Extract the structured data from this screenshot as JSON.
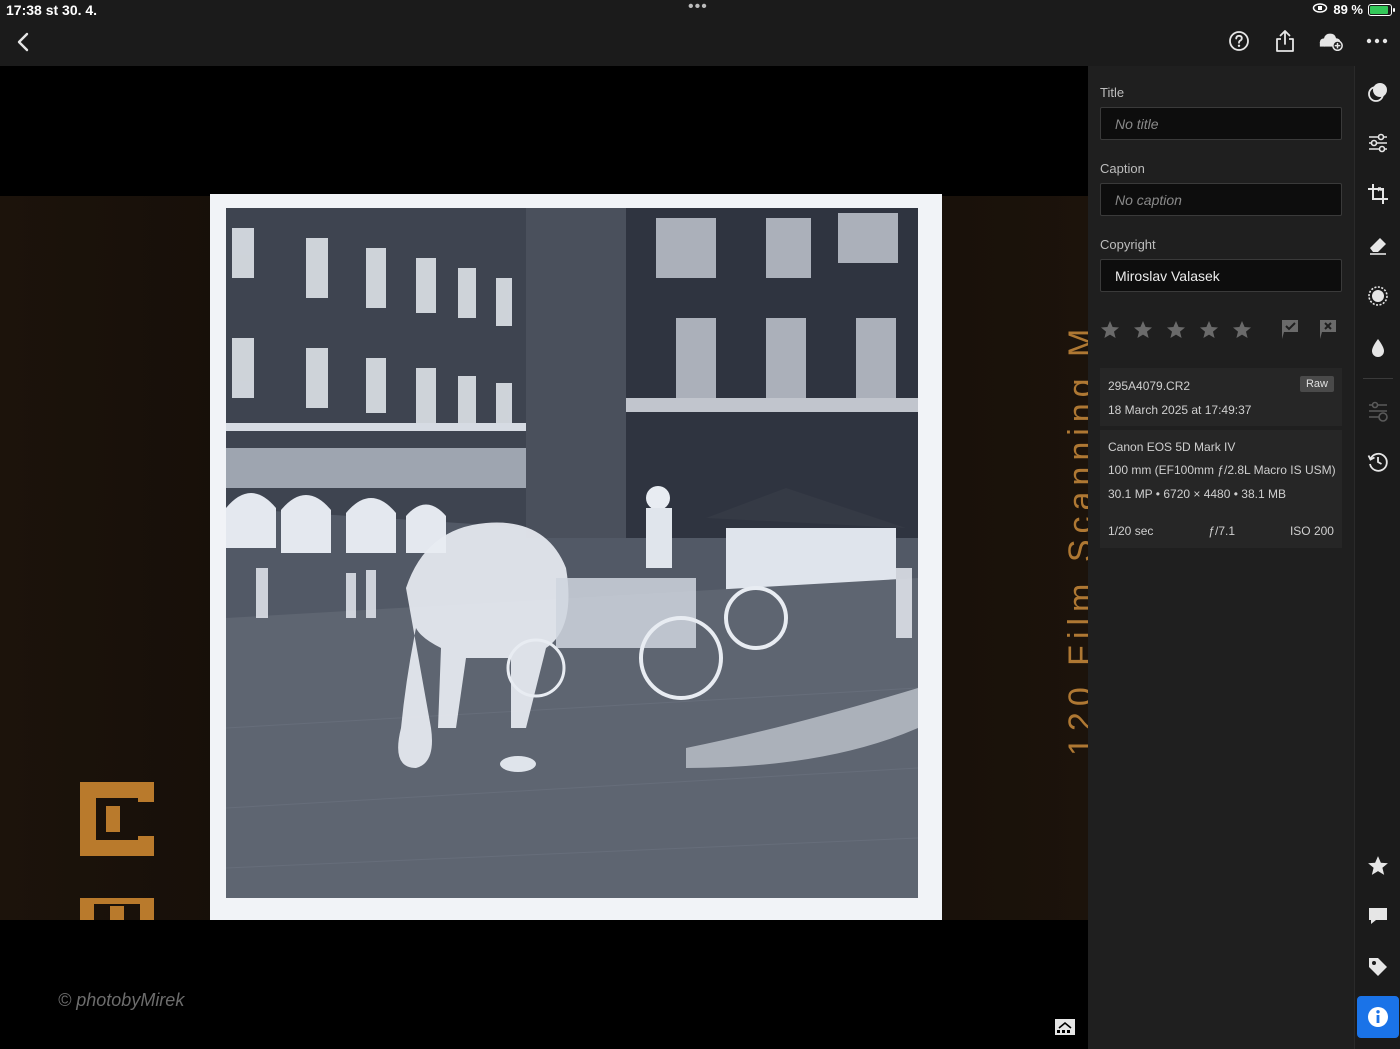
{
  "status": {
    "time_date": "17:38   st 30. 4.",
    "multitask_dots": "•••",
    "battery_percent": "89 %",
    "battery_level": 0.89
  },
  "toolbar": {
    "icons": [
      "back-icon",
      "help-icon",
      "share-icon",
      "cloud-add-icon",
      "more-icon"
    ]
  },
  "viewer": {
    "watermark": "© photobyMirek",
    "film_edge_text": "120 Film Scanning M"
  },
  "info": {
    "title_label": "Title",
    "title_placeholder": "No title",
    "caption_label": "Caption",
    "caption_placeholder": "No caption",
    "copyright_label": "Copyright",
    "copyright_value": "Miroslav Valasek",
    "rating": 0,
    "file_name": "295A4079.CR2",
    "file_type": "Raw",
    "capture_date": "18 March 2025 at 17:49:37",
    "camera": "Canon EOS 5D Mark IV",
    "lens": "100 mm (EF100mm ƒ/2.8L Macro IS USM)",
    "dimensions": "30.1 MP • 6720 × 4480 • 38.1 MB",
    "shutter": "1/20 sec",
    "aperture": "ƒ/7.1",
    "iso": "ISO 200"
  },
  "rail": {
    "icons": [
      "presets-icon",
      "adjust-icon",
      "crop-icon",
      "healing-icon",
      "masking-icon",
      "color-drop-icon",
      "versions-icon",
      "history-icon",
      "rate-icon",
      "comments-icon",
      "keyword-icon",
      "info-icon"
    ],
    "active": "info-icon"
  },
  "colors": {
    "accent": "#1a73e8",
    "battery": "#34c759",
    "film_orange": "#c98a3a"
  }
}
